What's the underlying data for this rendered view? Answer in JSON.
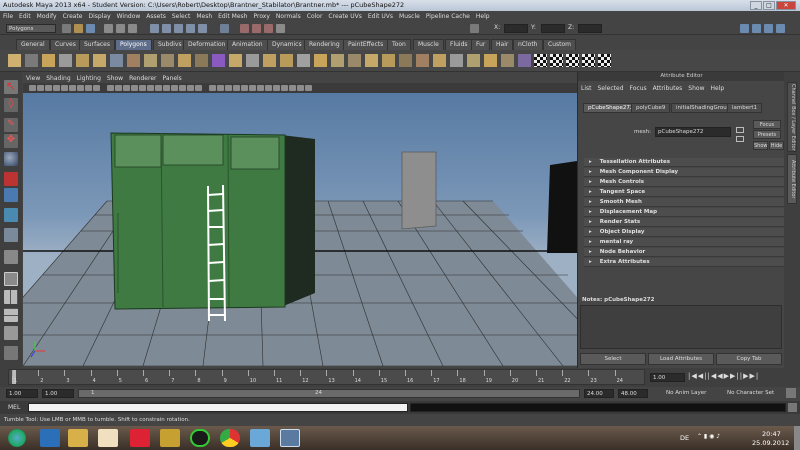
{
  "window": {
    "title": "Autodesk Maya 2013 x64 - Student Version: C:\\Users\\Robert\\Desktop\\Brantner_Stabilator\\Brantner.mb* --- pCubeShape272",
    "controls": [
      "_",
      "□",
      "✕"
    ]
  },
  "menubar": [
    "File",
    "Edit",
    "Modify",
    "Create",
    "Display",
    "Window",
    "Assets",
    "Select",
    "Mesh",
    "Edit Mesh",
    "Proxy",
    "Normals",
    "Color",
    "Create UVs",
    "Edit UVs",
    "Muscle",
    "Pipeline Cache",
    "Help"
  ],
  "statusline": {
    "mode": "Polygons",
    "coord_labels": [
      "X:",
      "Y:",
      "Z:"
    ]
  },
  "shelf_tabs": [
    "General",
    "Curves",
    "Surfaces",
    "Polygons",
    "Subdivs",
    "Deformation",
    "Animation",
    "Dynamics",
    "Rendering",
    "PaintEffects",
    "Toon",
    "Muscle",
    "Fluids",
    "Fur",
    "Hair",
    "nCloth",
    "Custom"
  ],
  "shelf_active": "Polygons",
  "viewport_menu": [
    "View",
    "Shading",
    "Lighting",
    "Show",
    "Renderer",
    "Panels"
  ],
  "attribute_editor": {
    "title": "Attribute Editor",
    "menu": [
      "List",
      "Selected",
      "Focus",
      "Attributes",
      "Show",
      "Help"
    ],
    "tabs": [
      "pCubeShape272",
      "polyCube9",
      "initialShadingGroup",
      "lambert1"
    ],
    "mesh_label": "mesh:",
    "mesh_value": "pCubeShape272",
    "focus_btn": "Focus",
    "presets_btn": "Presets",
    "show_btn": "Show",
    "hide_btn": "Hide",
    "sections": [
      "Tessellation Attributes",
      "Mesh Component Display",
      "Mesh Controls",
      "Tangent Space",
      "Smooth Mesh",
      "Displacement Map",
      "Render Stats",
      "Object Display",
      "mental ray",
      "Node Behavior",
      "Extra Attributes"
    ],
    "notes": "Notes:  pCubeShape272",
    "bottom_buttons": [
      "Select",
      "Load Attributes",
      "Copy Tab"
    ]
  },
  "side_tabs": [
    "Channel Box / Layer Editor",
    "Attribute Editor"
  ],
  "timeline": {
    "ticks": [
      "1",
      "2",
      "3",
      "4",
      "5",
      "6",
      "7",
      "8",
      "9",
      "10",
      "11",
      "12",
      "13",
      "14",
      "15",
      "16",
      "17",
      "18",
      "19",
      "20",
      "21",
      "22",
      "23",
      "24"
    ],
    "current_frame": "1.00",
    "range_start": "1.00",
    "range_inner_start": "1.00",
    "range_slider_start": "1",
    "range_slider_end": "24",
    "range_end": "24.00",
    "range_outer_end": "48.00",
    "anim_layer": "No Anim Layer",
    "character_set": "No Character Set"
  },
  "cmdline": {
    "label": "MEL"
  },
  "helpline": "Tumble Tool: Use LMB or MMB to tumble. Shift to constrain rotation.",
  "taskbar": {
    "lang": "DE",
    "time": "20:47",
    "date": "25.09.2012"
  }
}
